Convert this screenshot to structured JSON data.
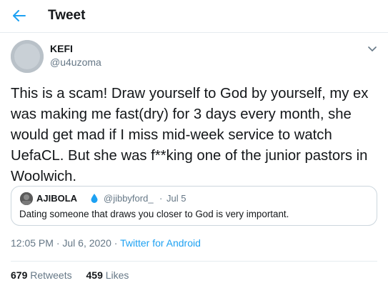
{
  "header": {
    "title": "Tweet",
    "back_icon": "arrow-left-icon",
    "accent": "#1da1f2"
  },
  "tweet": {
    "author_name": "KEFI",
    "author_handle": "@u4uzoma",
    "text": "This is a scam! Draw yourself to God by yourself, my ex\nwas making me fast(dry) for 3 days every month, she\nwould get mad if I miss mid-week service to watch\nUefaCL. But she was f**king one of the junior pastors in\nWoolwich.",
    "time": "12:05 PM · Jul 6, 2020",
    "separator": " · ",
    "source": "Twitter for Android"
  },
  "quote": {
    "author_name": "AJIBOLA",
    "author_handle": "@jibbyford_",
    "dot": "·",
    "date": "Jul 5",
    "text": "Dating someone that draws you closer to God is very important."
  },
  "stats": {
    "retweets_count": "679",
    "retweets_label": "Retweets",
    "likes_count": "459",
    "likes_label": "Likes"
  }
}
